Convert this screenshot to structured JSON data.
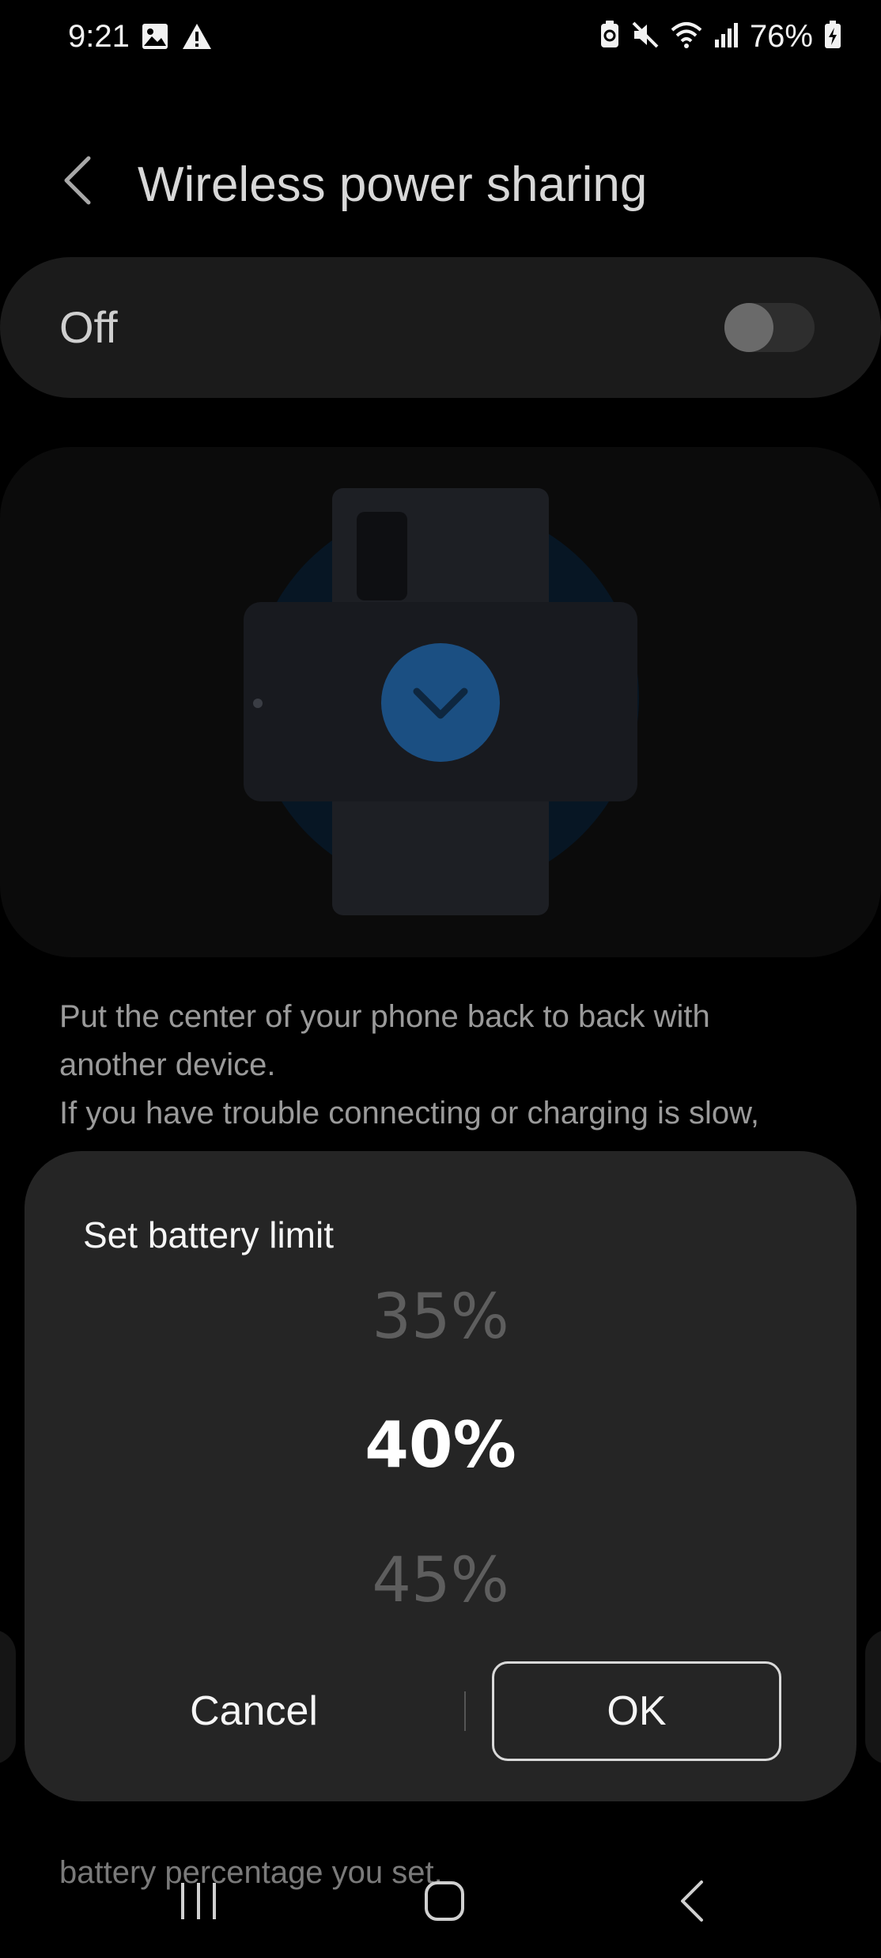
{
  "status_bar": {
    "time": "9:21",
    "battery_percent": "76%",
    "left_icons": [
      "gallery-icon",
      "warning-icon"
    ],
    "right_icons": [
      "nfc-icon",
      "mute-icon",
      "wifi-icon",
      "signal-icon",
      "battery-charging-icon"
    ]
  },
  "header": {
    "title": "Wireless power sharing"
  },
  "master_switch": {
    "label": "Off",
    "state": "off"
  },
  "description": {
    "line1": "Put the center of your phone back to back with",
    "line2": "another device.",
    "line3": "If you have trouble connecting or charging is slow,",
    "bottom": "battery percentage you set."
  },
  "dialog": {
    "title": "Set battery limit",
    "options": {
      "previous": "35%",
      "selected": "40%",
      "next": "45%"
    },
    "cancel_label": "Cancel",
    "ok_label": "OK"
  },
  "colors": {
    "dialog_bg": "#252525",
    "accent_blue": "#1b4f82"
  }
}
